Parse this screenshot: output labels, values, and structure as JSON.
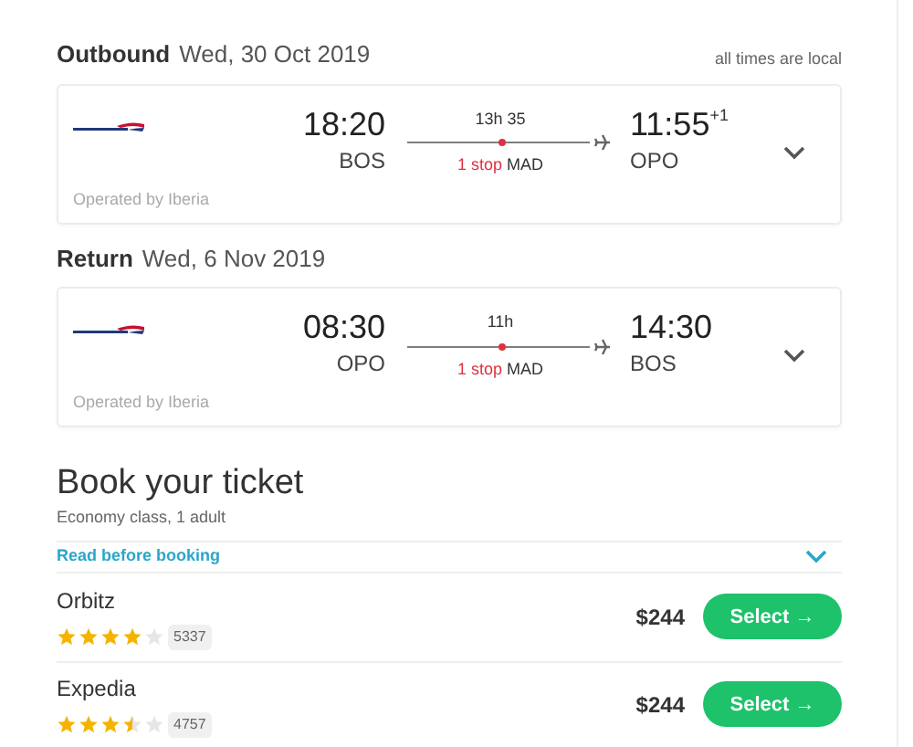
{
  "note": "all times are local",
  "legs": [
    {
      "label": "Outbound",
      "date": "Wed, 30 Oct 2019",
      "depart_time": "18:20",
      "depart_code": "BOS",
      "duration": "13h 35",
      "stops": "1 stop",
      "via": "MAD",
      "arrive_time": "11:55",
      "day_offset": "+1",
      "arrive_code": "OPO",
      "operator": "Operated by Iberia"
    },
    {
      "label": "Return",
      "date": "Wed, 6 Nov 2019",
      "depart_time": "08:30",
      "depart_code": "OPO",
      "duration": "11h",
      "stops": "1 stop",
      "via": "MAD",
      "arrive_time": "14:30",
      "arrive_code": "BOS",
      "operator": "Operated by Iberia"
    }
  ],
  "booking": {
    "title": "Book your ticket",
    "subtitle": "Economy class, 1 adult",
    "notice": "Read before booking",
    "offers": [
      {
        "name": "Orbitz",
        "stars": 4,
        "reviews": "5337",
        "price": "$244",
        "button": "Select →"
      },
      {
        "name": "Expedia",
        "stars": 3.5,
        "reviews": "4757",
        "price": "$244",
        "button": "Select →"
      }
    ]
  }
}
